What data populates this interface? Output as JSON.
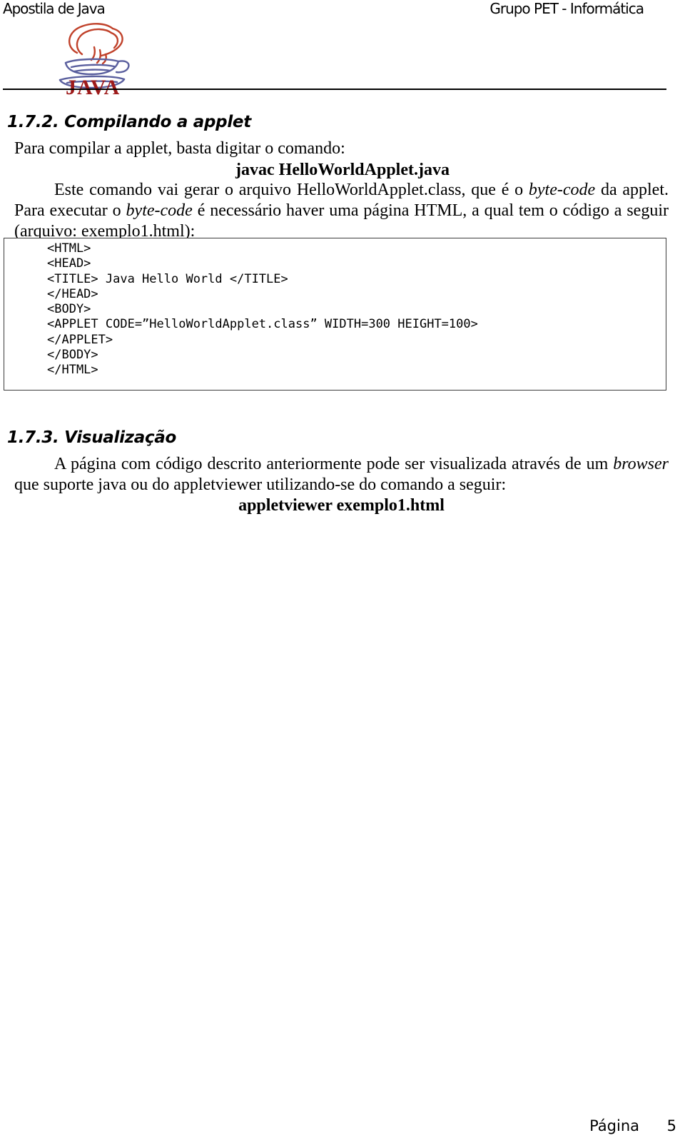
{
  "header": {
    "left_title": "Apostila de Java",
    "right_title": "Grupo PET - Informática",
    "logo_wordmark": "JAVA"
  },
  "sections": [
    {
      "number": "1.7.2.",
      "heading": "1.7.2. Compilando a applet",
      "intro_text": "Para compilar a applet, basta digitar o comando:",
      "command": "javac HelloWorldApplet.java",
      "paragraph_parts": [
        "Este comando vai gerar o arquivo HelloWorldApplet.class, que é o ",
        "byte-code",
        " da applet. Para executar o ",
        "byte-code",
        " é necessário haver uma página HTML, a qual tem o código a seguir (arquivo: exemplo1.html):"
      ]
    },
    {
      "number": "1.7.3.",
      "heading": "1.7.3. Visualização",
      "paragraph_parts": [
        "A página com código descrito anteriormente pode ser visualizada através de um ",
        "browser",
        " que suporte java ou do appletviewer utilizando-se do comando a seguir:"
      ],
      "command": "appletviewer exemplo1.html"
    }
  ],
  "code_block": {
    "language": "html",
    "lines": [
      "<HTML>",
      "<HEAD>",
      "<TITLE> Java Hello World </TITLE>",
      "</HEAD>",
      "<BODY>",
      "<APPLET CODE=”HelloWorldApplet.class” WIDTH=300 HEIGHT=100>",
      "</APPLET>",
      "</BODY>",
      "</HTML>"
    ],
    "text": "<HTML>\n<HEAD>\n<TITLE> Java Hello World </TITLE>\n</HEAD>\n<BODY>\n<APPLET CODE=”HelloWorldApplet.class” WIDTH=300 HEIGHT=100>\n</APPLET>\n</BODY>\n</HTML>"
  },
  "footer": {
    "label": "Página",
    "page_number": "5"
  },
  "colors": {
    "text": "#000000",
    "page_background": "#ffffff",
    "code_border": "#3c3c3c",
    "logo_steam": "#c0412a",
    "logo_cup": "#5a5f9e",
    "logo_wordmark": "#9e1b1b"
  }
}
